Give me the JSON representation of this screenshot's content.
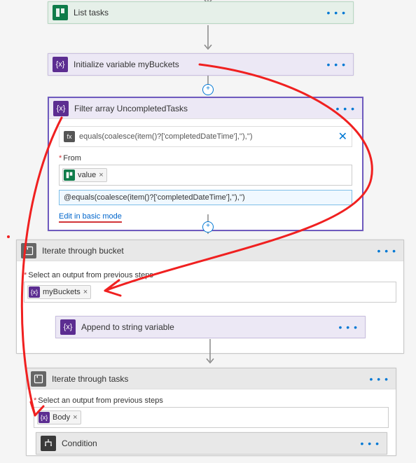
{
  "steps": {
    "list_tasks": {
      "title": "List tasks"
    },
    "init_var": {
      "title": "Initialize variable myBuckets"
    },
    "filter": {
      "title": "Filter array UncompletedTasks",
      "fx_expr": "equals(coalesce(item()?['completedDateTime'],''),'')",
      "from_label": "From",
      "from_token": "value",
      "advanced_expr": "@equals(coalesce(item()?['completedDateTime'],''),'')",
      "edit_mode": "Edit in basic mode"
    },
    "iter_bucket": {
      "title": "Iterate through bucket",
      "select_label": "Select an output from previous steps",
      "token": "myBuckets"
    },
    "append": {
      "title": "Append to string variable"
    },
    "iter_tasks": {
      "title": "Iterate through tasks",
      "select_label": "Select an output from previous steps",
      "token": "Body"
    },
    "condition": {
      "title": "Condition"
    }
  },
  "glyphs": {
    "menu": "• • •",
    "token_x": "×",
    "close_x": "✕",
    "required": "*"
  }
}
